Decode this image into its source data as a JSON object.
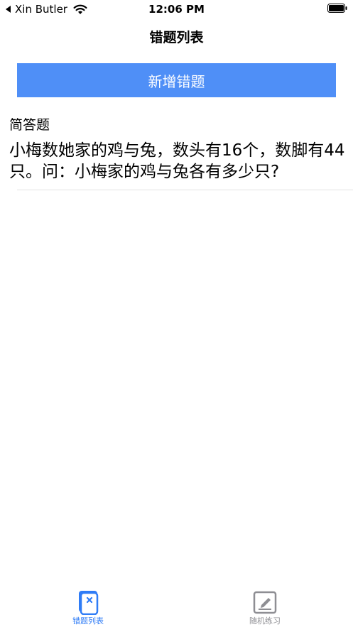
{
  "status_bar": {
    "back_app": "Xin Butler",
    "time": "12:06 PM"
  },
  "nav": {
    "title": "错题列表"
  },
  "actions": {
    "add_label": "新增错题",
    "button_color": "#4f8ff7"
  },
  "questions": [
    {
      "type": "简答题",
      "text": "小梅数她家的鸡与兔，数头有16个，数脚有44只。问：小梅家的鸡与兔各有多少只?"
    }
  ],
  "tab_bar": {
    "active_color": "#2f7cf6",
    "inactive_color": "#8e8e93",
    "tabs": [
      {
        "label": "错题列表",
        "icon": "notebook-icon",
        "active": true
      },
      {
        "label": "随机练习",
        "icon": "edit-icon",
        "active": false
      }
    ]
  }
}
